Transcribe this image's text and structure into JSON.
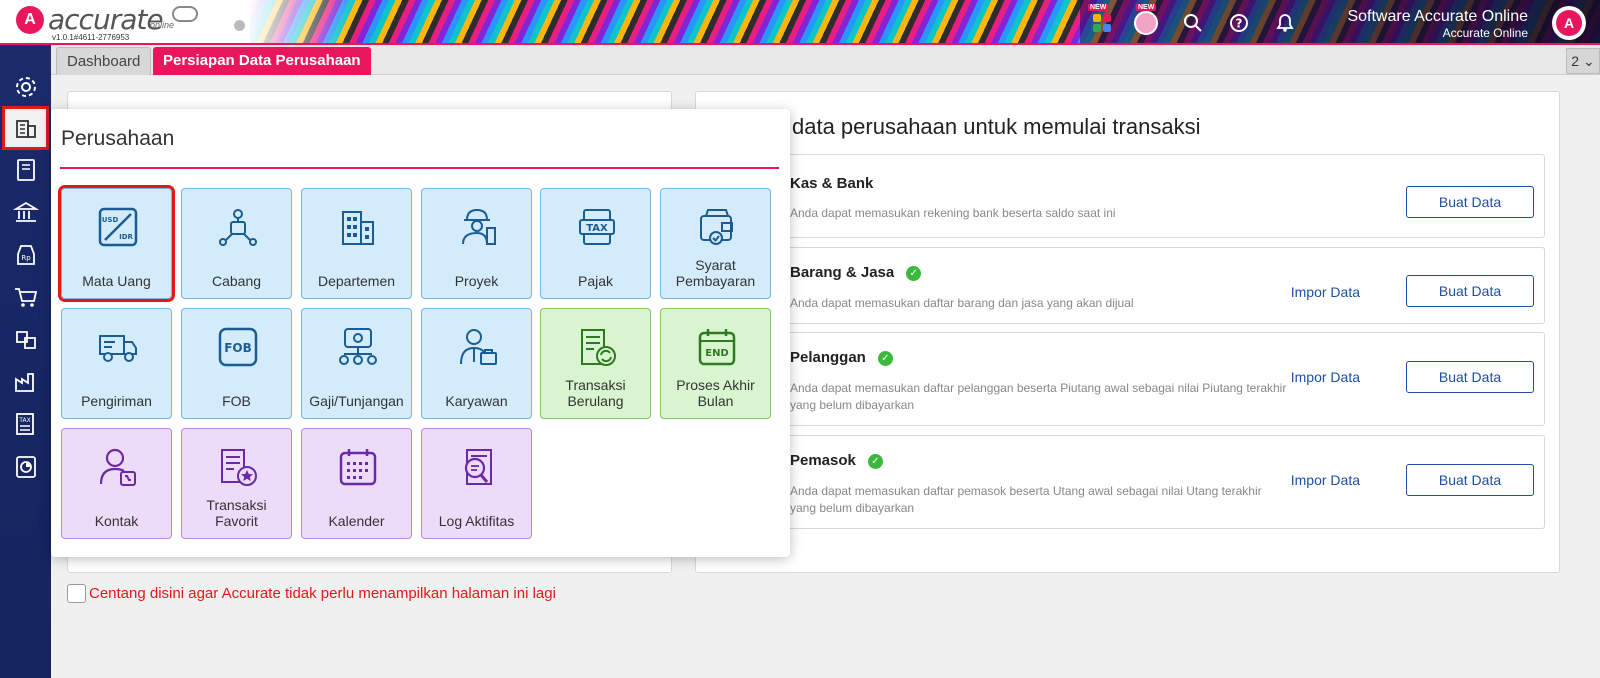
{
  "header": {
    "brand": "accurate",
    "brand_sub": "online",
    "version": "v1.0.1#4611-2776953",
    "new_badge": "NEW",
    "company_name": "Software Accurate Online",
    "company_sub": "Accurate Online",
    "user_initial": "A",
    "icons": [
      "apps-icon",
      "mascot-icon",
      "search-icon",
      "help-icon",
      "bell-icon"
    ]
  },
  "tabs": {
    "items": [
      {
        "label": "Dashboard"
      },
      {
        "label": "Persiapan Data Perusahaan"
      }
    ],
    "more": "2 ⌄"
  },
  "sidebar": {
    "items": [
      "settings-icon",
      "company-icon",
      "ledger-icon",
      "bank-icon",
      "sales-icon",
      "cart-icon",
      "inventory-icon",
      "factory-icon",
      "tax-icon",
      "report-icon"
    ]
  },
  "popup": {
    "title": "Perusahaan",
    "tiles": [
      {
        "label": "Mata Uang"
      },
      {
        "label": "Cabang"
      },
      {
        "label": "Departemen"
      },
      {
        "label": "Proyek"
      },
      {
        "label": "Pajak"
      },
      {
        "label": "Syarat Pembayaran"
      },
      {
        "label": "Pengiriman"
      },
      {
        "label": "FOB"
      },
      {
        "label": "Gaji/Tunjangan"
      },
      {
        "label": "Karyawan"
      },
      {
        "label": "Transaksi Berulang"
      },
      {
        "label": "Proses Akhir Bulan"
      },
      {
        "label": "Kontak"
      },
      {
        "label": "Transaksi Favorit"
      },
      {
        "label": "Kalender"
      },
      {
        "label": "Log Aktifitas"
      }
    ],
    "icon_text": {
      "usd": "USD",
      "idr": "IDR",
      "tax": "TAX",
      "fob": "FOB",
      "end": "END"
    }
  },
  "right_panel": {
    "title": "data perusahaan untuk memulai transaksi",
    "rows": [
      {
        "title": "Kas & Bank",
        "desc": "Anda dapat memasukan rekening bank beserta saldo saat ini",
        "button": "Buat Data"
      },
      {
        "title": "Barang & Jasa",
        "desc": "Anda dapat memasukan daftar barang dan jasa yang akan dijual",
        "import": "Impor Data",
        "button": "Buat Data"
      },
      {
        "title": "Pelanggan",
        "desc": "Anda dapat memasukan daftar pelanggan beserta Piutang awal sebagai nilai Piutang terakhir yang belum dibayarkan",
        "import": "Impor Data",
        "button": "Buat Data"
      },
      {
        "title": "Pemasok",
        "desc": "Anda dapat memasukan daftar pemasok beserta Utang awal sebagai nilai Utang terakhir yang belum dibayarkan",
        "import": "Impor Data",
        "button": "Buat Data"
      }
    ]
  },
  "footer": {
    "checkbox_label": "Centang disini agar Accurate tidak perlu menampilkan halaman ini lagi"
  }
}
